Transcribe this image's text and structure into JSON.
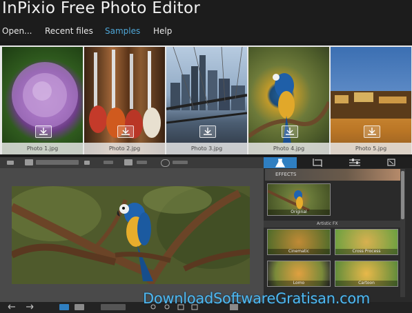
{
  "app": {
    "title": "InPixio Free Photo Editor"
  },
  "menu": [
    {
      "label": "Open..."
    },
    {
      "label": "Recent files"
    },
    {
      "label": "Samples",
      "active": true
    },
    {
      "label": "Help"
    }
  ],
  "samples": [
    {
      "caption": "Photo 1.jpg"
    },
    {
      "caption": "Photo 2.jpg"
    },
    {
      "caption": "Photo 3.jpg"
    },
    {
      "caption": "Photo 4.jpg"
    },
    {
      "caption": "Photo 5.jpg"
    }
  ],
  "editor": {
    "effects_label": "EFFECTS",
    "original_label": "Original",
    "artistic_label": "Artistic FX"
  },
  "fx_items": [
    {
      "label": "Cinematic"
    },
    {
      "label": "Cross Process"
    },
    {
      "label": "Lomo"
    },
    {
      "label": "Cartoon"
    }
  ],
  "watermark": "DownloadSoftwareGratisan.com",
  "colors": {
    "accent": "#2f7fc1",
    "menu_active": "#4fa7d8",
    "watermark": "#4fb8f0"
  }
}
